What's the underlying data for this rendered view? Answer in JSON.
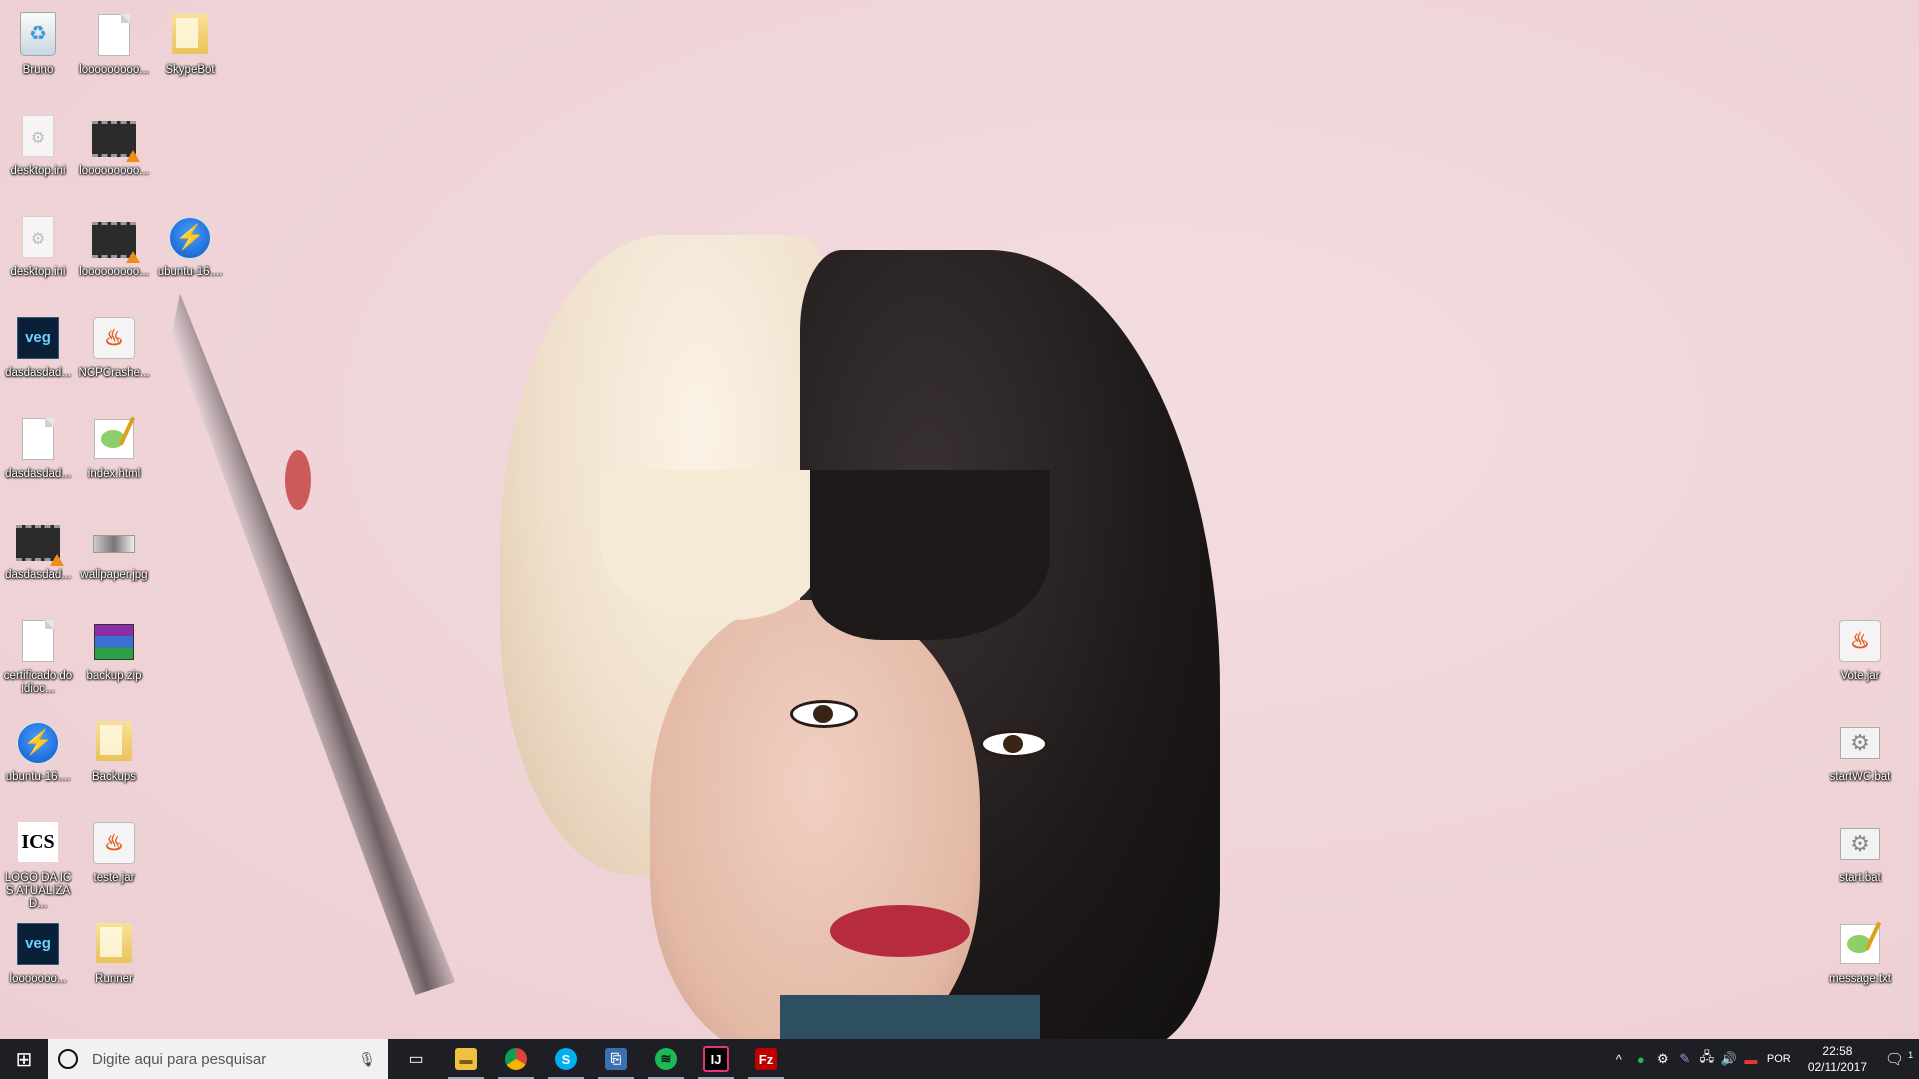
{
  "desktop": {
    "icons": [
      {
        "label": "Bruno"
      },
      {
        "label": "looooooooo..."
      },
      {
        "label": "SkypeBot"
      },
      {
        "label": "desktop.ini"
      },
      {
        "label": "looooooooo..."
      },
      {
        "label": "desktop.ini"
      },
      {
        "label": "looooooooo..."
      },
      {
        "label": "ubuntu-16...."
      },
      {
        "label": "dasdasdad..."
      },
      {
        "label": "NCPCrashe..."
      },
      {
        "label": "dasdasdad..."
      },
      {
        "label": "index.html"
      },
      {
        "label": "dasdasdad..."
      },
      {
        "label": "wallpaper.jpg"
      },
      {
        "label": "certificado do idioc..."
      },
      {
        "label": "backup.zip"
      },
      {
        "label": "ubuntu-16...."
      },
      {
        "label": "Backups"
      },
      {
        "label": "LOGO DA ICS ATUALIZAD..."
      },
      {
        "label": "teste.jar"
      },
      {
        "label": "looooooo..."
      },
      {
        "label": "Runner"
      },
      {
        "label": "Vote.jar"
      },
      {
        "label": "startWC.bat"
      },
      {
        "label": "start.bat"
      },
      {
        "label": "message.txt"
      }
    ],
    "icon_texts": {
      "veg": "veg",
      "ics": "ICS"
    }
  },
  "taskbar": {
    "search_placeholder": "Digite aqui para pesquisar",
    "language": "POR",
    "time": "22:58",
    "date": "02/11/2017",
    "notification_count": "1"
  }
}
